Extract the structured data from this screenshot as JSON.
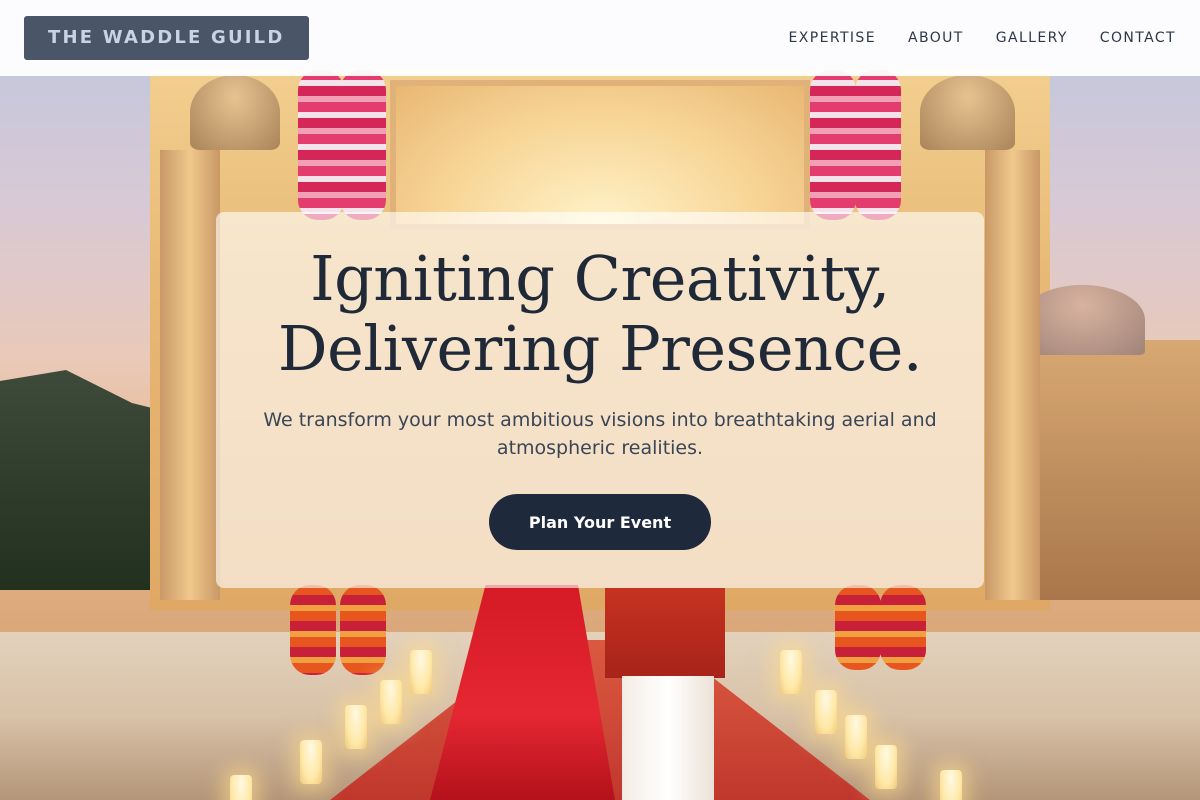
{
  "header": {
    "logo": "THE WADDLE GUILD",
    "nav": [
      {
        "label": "EXPERTISE"
      },
      {
        "label": "ABOUT"
      },
      {
        "label": "GALLERY"
      },
      {
        "label": "CONTACT"
      }
    ]
  },
  "hero": {
    "title_line1": "Igniting Creativity,",
    "title_line2": "Delivering Presence.",
    "subtitle": "We transform your most ambitious visions into breathtaking aerial and atmospheric realities.",
    "cta_label": "Plan Your Event"
  },
  "colors": {
    "logo_bg": "#4a5568",
    "logo_text": "#c9d3e3",
    "cta_bg": "#1e293b",
    "heading_text": "#1f2937"
  }
}
